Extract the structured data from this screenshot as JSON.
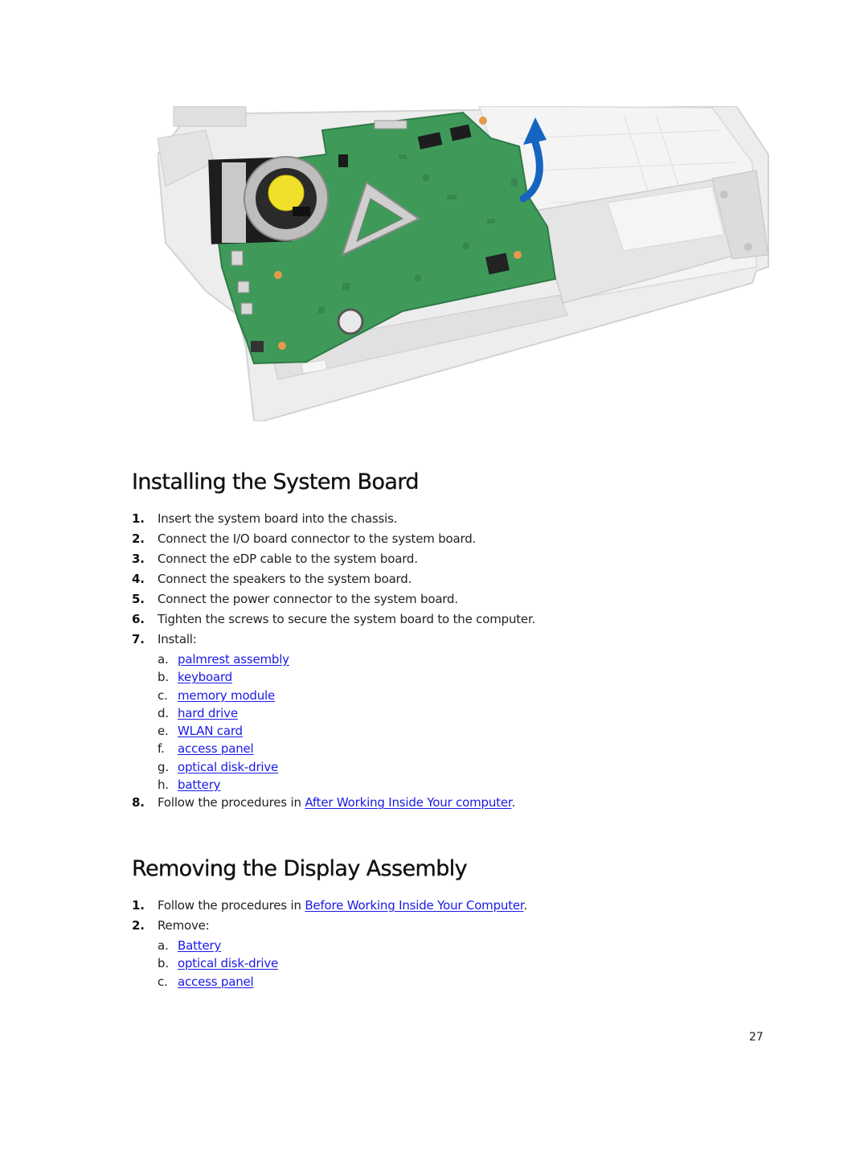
{
  "figure": {
    "alt": "System board being lifted from the laptop chassis with a blue arrow indicating upward removal",
    "icon": "upward-curved-arrow",
    "arrow_color": "#1565c0",
    "board_color": "#3f9a5a"
  },
  "section_install": {
    "title": "Installing the System Board",
    "steps": [
      {
        "num": "1.",
        "text": "Insert the system board into the chassis."
      },
      {
        "num": "2.",
        "text": "Connect the I/O board connector to the system board."
      },
      {
        "num": "3.",
        "text": "Connect the eDP cable to the system board."
      },
      {
        "num": "4.",
        "text": "Connect the speakers to the system board."
      },
      {
        "num": "5.",
        "text": "Connect the power connector to the system board."
      },
      {
        "num": "6.",
        "text": "Tighten the screws to secure the system board to the computer."
      },
      {
        "num": "7.",
        "text": "Install:"
      }
    ],
    "install_items": [
      {
        "letter": "a.",
        "link": "palmrest assembly"
      },
      {
        "letter": "b.",
        "link": "keyboard"
      },
      {
        "letter": "c.",
        "link": "memory module"
      },
      {
        "letter": "d.",
        "link": "hard drive"
      },
      {
        "letter": "e.",
        "link": "WLAN card"
      },
      {
        "letter": "f.",
        "link": "access panel"
      },
      {
        "letter": "g.",
        "link": "optical disk-drive"
      },
      {
        "letter": "h.",
        "link": "battery"
      }
    ],
    "final_step": {
      "num": "8.",
      "prefix": "Follow the procedures in ",
      "link": "After Working Inside Your computer",
      "suffix": "."
    }
  },
  "section_remove": {
    "title": "Removing the Display Assembly",
    "steps": [
      {
        "num": "1.",
        "prefix": "Follow the procedures in ",
        "link": "Before Working Inside Your Computer",
        "suffix": "."
      },
      {
        "num": "2.",
        "text": "Remove:"
      }
    ],
    "remove_items": [
      {
        "letter": "a.",
        "link": "Battery"
      },
      {
        "letter": "b.",
        "link": "optical disk-drive"
      },
      {
        "letter": "c.",
        "link": "access panel"
      }
    ]
  },
  "page_number": "27",
  "colors": {
    "link": "#1a1ae6",
    "text": "#222222",
    "heading": "#111111"
  }
}
